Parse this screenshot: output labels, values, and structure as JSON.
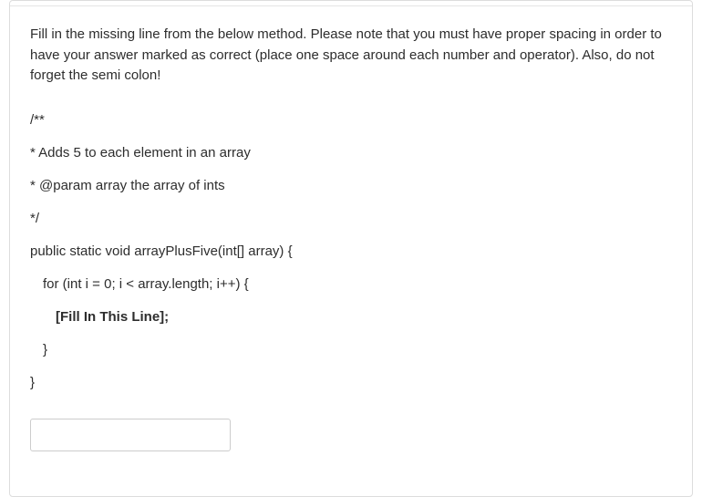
{
  "question": {
    "instructions": "Fill in the missing line from the below method. Please note that you must have proper spacing in order to have your answer marked as correct (place one space around each number and operator). Also, do not forget the semi colon!",
    "code": {
      "line1": "/**",
      "line2": "* Adds 5 to each element in an array",
      "line3": "* @param array the array of ints",
      "line4": "*/",
      "line5": "public static void arrayPlusFive(int[] array) {",
      "line6": "for (int i = 0; i < array.length; i++) {",
      "line7": "[Fill In This Line];",
      "line8": "}",
      "line9": "}"
    },
    "answer_value": ""
  }
}
